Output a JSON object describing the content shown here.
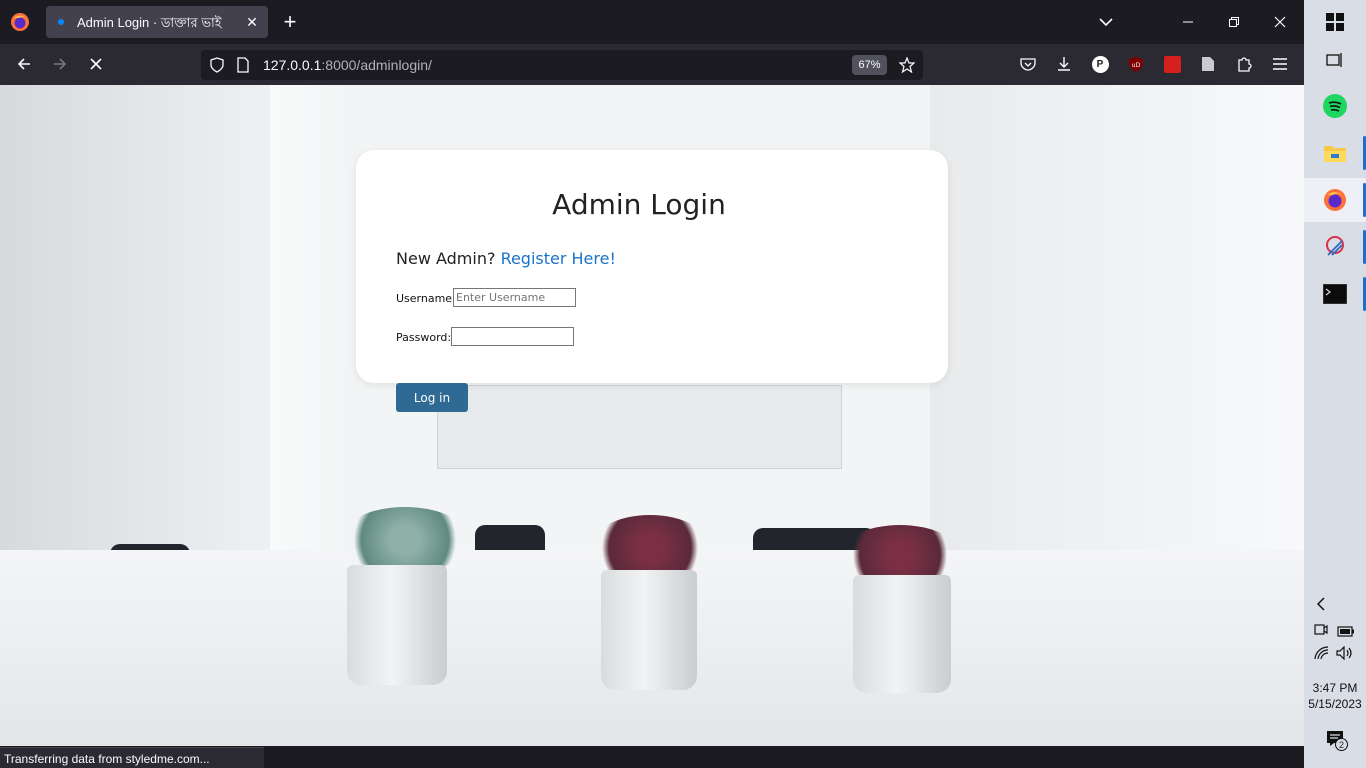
{
  "browser": {
    "tab_title": "Admin Login · ডাক্তার ভাই",
    "url_host": "127.0.0.1",
    "url_path": ":8000/adminlogin/",
    "zoom": "67%",
    "status_text": "Transferring data from styledme.com..."
  },
  "login": {
    "title": "Admin Login",
    "new_admin_prompt": "New Admin?",
    "register_link": "Register Here!",
    "username_label": "Username:",
    "username_placeholder": "Enter Username",
    "password_label": "Password:",
    "login_button": "Log in"
  },
  "taskbar": {
    "time": "3:47 PM",
    "date": "5/15/2023",
    "notification_count": "2",
    "apps": [
      "spotify",
      "file-explorer",
      "firefox",
      "snipping-tool",
      "terminal"
    ]
  },
  "colors": {
    "accent_link": "#1a73c9",
    "login_button": "#2e6a93",
    "browser_dark": "#1c1b22"
  }
}
